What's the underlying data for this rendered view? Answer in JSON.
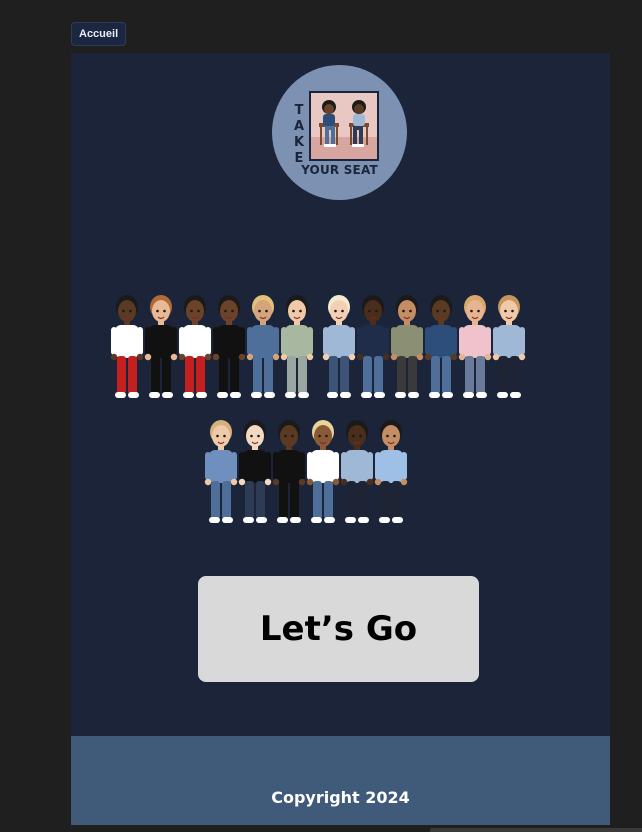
{
  "nav": {
    "home_label": "Accueil"
  },
  "logo": {
    "word_vertical": "TAKE",
    "tagline": "YOUR SEAT",
    "icon": "two-characters-seated-logo"
  },
  "crowd": {
    "icon": "bitmoji-group-illustration",
    "rows": [
      {
        "figures": [
          {
            "skin": "#5b3a23",
            "hair": "#1a1a1a",
            "top": "#ffffff",
            "bottom": "#c42020"
          },
          {
            "skin": "#e9b996",
            "hair": "#b06a35",
            "top": "#111111",
            "bottom": "#111111"
          },
          {
            "skin": "#6b4329",
            "hair": "#1a1a1a",
            "top": "#ffffff",
            "bottom": "#c42020"
          },
          {
            "skin": "#6b4329",
            "hair": "#1a1a1a",
            "top": "#111111",
            "bottom": "#111111"
          },
          {
            "skin": "#d5a47c",
            "hair": "#e2c27a",
            "top": "#4f6f9b",
            "bottom": "#4f6f9b"
          },
          {
            "skin": "#f0c9a8",
            "hair": "#1a1a1a",
            "top": "#a8b8a0",
            "bottom": "#9aa6a0"
          },
          {
            "skin": "#f3d0b3",
            "hair": "#f2ead0",
            "top": "#9fb8d6",
            "bottom": "#3d5378"
          },
          {
            "skin": "#4a2e1c",
            "hair": "#1a1a1a",
            "top": "#1f2c4a",
            "bottom": "#4f6f9b"
          },
          {
            "skin": "#c48d64",
            "hair": "#1a1a1a",
            "top": "#8b8f73",
            "bottom": "#3a3a3a"
          },
          {
            "skin": "#5b3a23",
            "hair": "#1a1a1a",
            "top": "#2d4d7a",
            "bottom": "#4f6f9b"
          },
          {
            "skin": "#e6b48f",
            "hair": "#d9a868",
            "top": "#f0c3cc",
            "bottom": "#6a7a9a"
          },
          {
            "skin": "#f0c9a8",
            "hair": "#c8945a",
            "top": "#9fb8d6",
            "bottom": "#1e2434"
          }
        ]
      },
      {
        "figures": [
          {
            "skin": "#f0c9a8",
            "hair": "#d6b27a",
            "top": "#6f8fbf",
            "bottom": "#4f6f9b"
          },
          {
            "skin": "#f3d9c1",
            "hair": "#1a1a1a",
            "top": "#111111",
            "bottom": "#2d3b55"
          },
          {
            "skin": "#5b3a23",
            "hair": "#1a1a1a",
            "top": "#111111",
            "bottom": "#111111"
          },
          {
            "skin": "#8a5a36",
            "hair": "#e8d49a",
            "top": "#ffffff",
            "bottom": "#4f6f9b"
          },
          {
            "skin": "#4a2e1c",
            "hair": "#1a1a1a",
            "top": "#9fb8d6",
            "bottom": "#1e2434"
          },
          {
            "skin": "#c48d64",
            "hair": "#1a1a1a",
            "top": "#9fc0e6",
            "bottom": "#1e2434"
          }
        ]
      }
    ]
  },
  "primary_action": {
    "label": "Let’s Go"
  },
  "footer": {
    "copyright": "Copyright 2024"
  },
  "colors": {
    "page_bg": "#1f1f1f",
    "frame_bg": "#1b2439",
    "logo_circle": "#7d92b3",
    "button_bg": "#d9d9d9",
    "footer_bg": "#405a7a",
    "footer_text": "#ffffff"
  }
}
